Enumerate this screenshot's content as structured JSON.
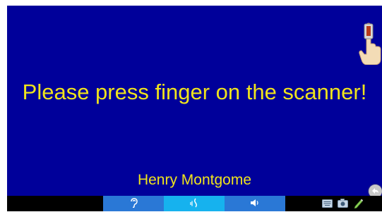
{
  "screen": {
    "prompt_text": "Please press finger on the scanner!",
    "user_name": "Henry Montgome"
  },
  "icons": {
    "hand": "finger-scanner-hand-icon",
    "back": "back-arrow-icon",
    "hearing": "ear-icon",
    "vibrate": "vibrate-icon",
    "volume": "speaker-icon",
    "keyboard": "keyboard-icon",
    "camera": "camera-icon",
    "pen": "pen-icon"
  },
  "colors": {
    "background": "#00009a",
    "text": "#f0e41c",
    "tab_normal": "#2a78d6",
    "tab_active": "#16b2ee",
    "bottom_bar": "#000000"
  }
}
